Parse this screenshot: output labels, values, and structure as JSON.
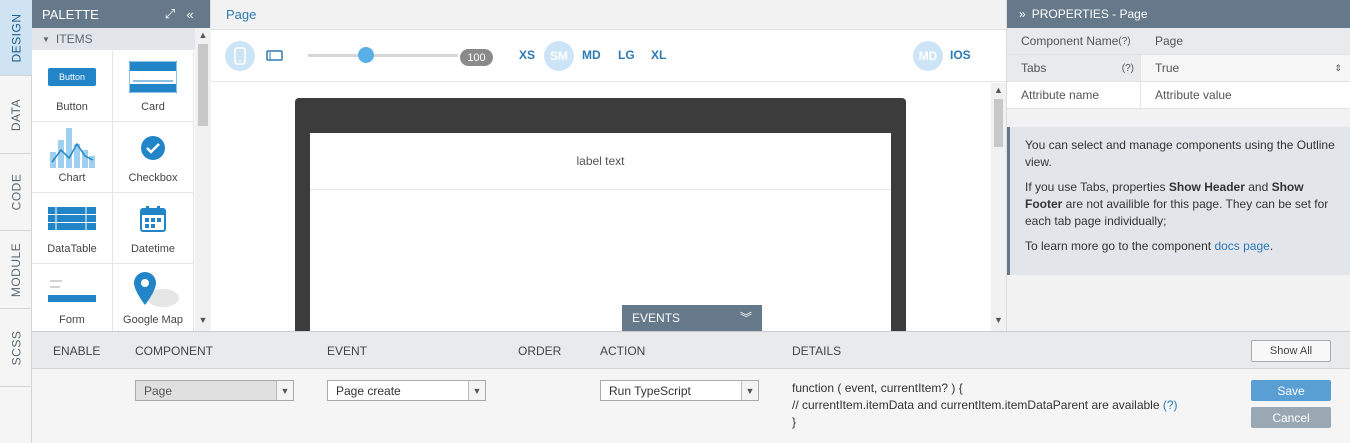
{
  "sidebar_tabs": [
    "DESIGN",
    "DATA",
    "CODE",
    "MODULE",
    "SCSS"
  ],
  "palette": {
    "title": "PALETTE",
    "section": "ITEMS",
    "items": [
      "Button",
      "Card",
      "Chart",
      "Checkbox",
      "DataTable",
      "Datetime",
      "Form",
      "Google Map"
    ],
    "button_icon_text": "Button"
  },
  "breadcrumb": "Page",
  "device_bar": {
    "zoom": "100",
    "breakpoints": [
      "XS",
      "SM",
      "MD",
      "LG",
      "XL"
    ],
    "selected_breakpoint": "SM",
    "platforms": [
      "MD",
      "IOS"
    ],
    "selected_platform": "MD"
  },
  "canvas": {
    "label_text": "label text"
  },
  "events_popup": {
    "title": "EVENTS"
  },
  "properties": {
    "title": "PROPERTIES - Page",
    "rows": [
      {
        "key": "Component Name",
        "help": "(?)",
        "value": "Page"
      },
      {
        "key": "Tabs",
        "help": "(?)",
        "value": "True"
      }
    ],
    "attr_name_placeholder": "Attribute name",
    "attr_value_placeholder": "Attribute value",
    "info": {
      "p1": "You can select and manage components using the Outline view.",
      "p2_a": "If you use Tabs, properties ",
      "p2_b": "Show Header",
      "p2_c": " and ",
      "p2_d": "Show Footer",
      "p2_e": " are not availible for this page. They can be set for each tab page individually;",
      "p3_a": "To learn more go to the component ",
      "p3_link": "docs page",
      "p3_b": "."
    }
  },
  "events_table": {
    "headers": [
      "ENABLE",
      "COMPONENT",
      "EVENT",
      "ORDER",
      "ACTION",
      "DETAILS"
    ],
    "show_all": "Show All",
    "component": "Page",
    "event": "Page create",
    "action": "Run TypeScript",
    "details_line1": "function ( event, currentItem? ) {",
    "details_line2": "// currentItem.itemData and currentItem.itemDataParent are available ",
    "details_help": "(?)",
    "details_line3": "}",
    "save": "Save",
    "cancel": "Cancel"
  }
}
